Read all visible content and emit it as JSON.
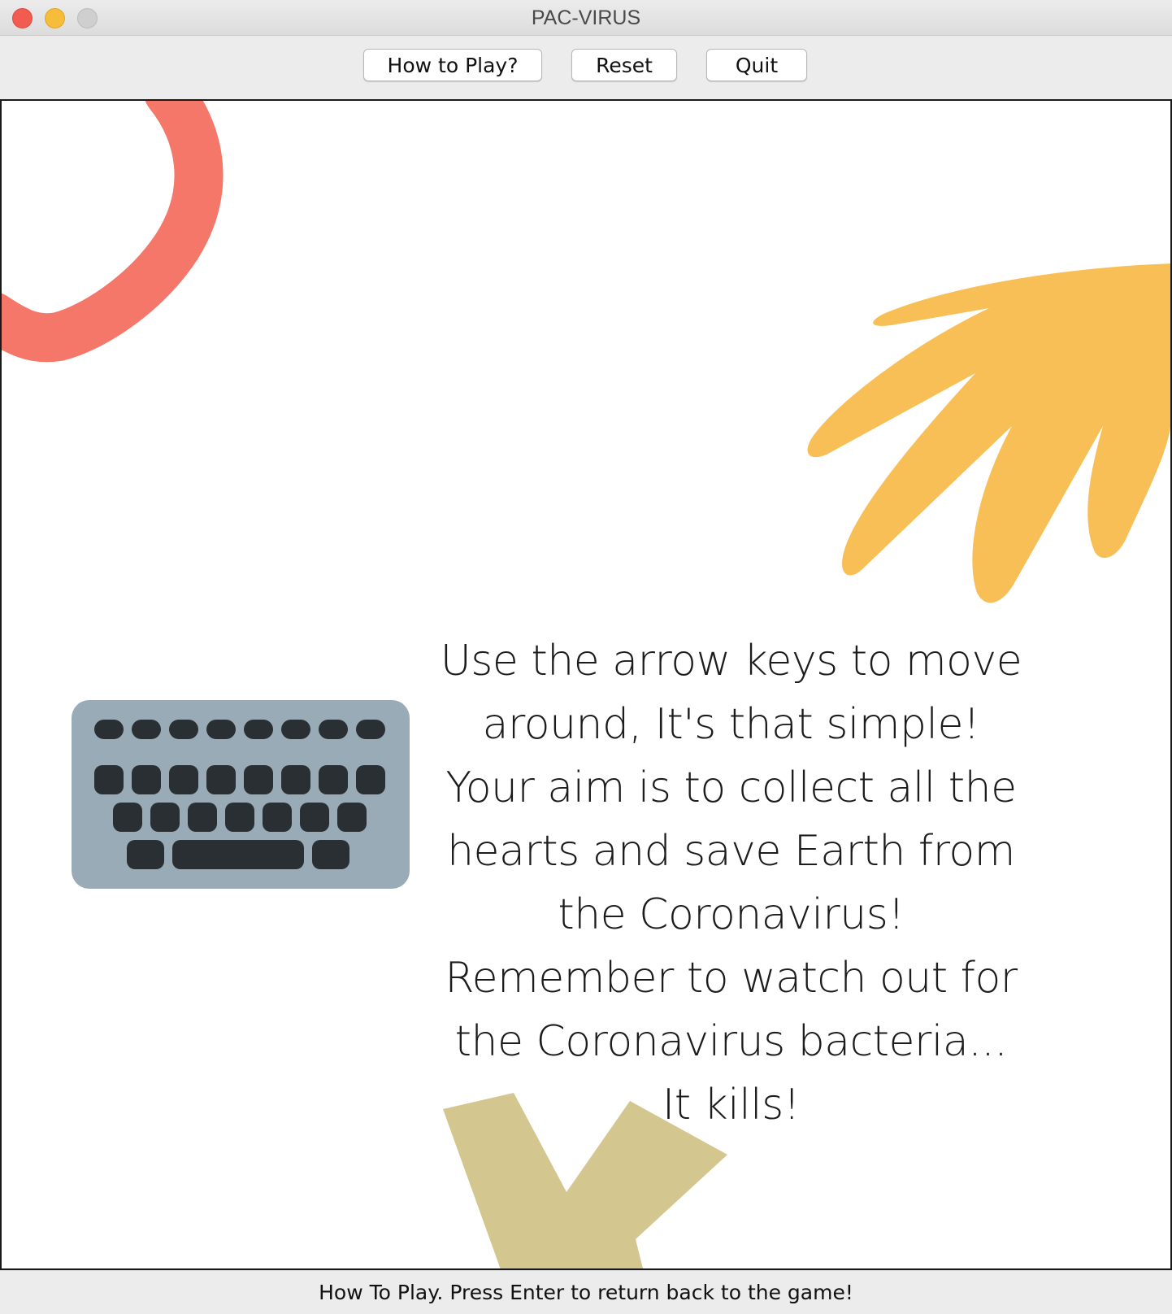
{
  "window": {
    "title": "PAC-VIRUS"
  },
  "toolbar": {
    "how_to_play_label": "How to Play?",
    "reset_label": "Reset",
    "quit_label": "Quit"
  },
  "instructions": {
    "lines": [
      "Use the arrow keys to move",
      "around, It's that simple!",
      "Your aim is to collect all the",
      "hearts and save Earth from",
      "the Coronavirus!",
      "Remember to watch out for",
      "the Coronavirus bacteria...",
      "It kills!"
    ]
  },
  "status": {
    "text": "How To Play. Press Enter to return back to the game!"
  },
  "icons": {
    "keyboard": "keyboard-icon"
  },
  "colors": {
    "coral_ring": "#f5776a",
    "yellow_leaf": "#f8bf57",
    "olive_shape": "#d4c68f",
    "keyboard_body": "#9aabb8",
    "keyboard_keys": "#292f33"
  }
}
